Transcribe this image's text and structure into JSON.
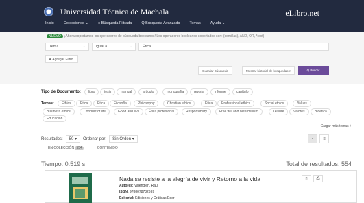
{
  "header": {
    "university": "Universidad Técnica de Machala",
    "brand": "eLibro.net",
    "nav": [
      "Inicio",
      "Colecciones ⌄",
      "≡ Búsqueda Filtrada",
      "Q Búsqueda Avanzada",
      "Temas",
      "Ayuda ⌄"
    ]
  },
  "search": {
    "notice_badge": "NUEVO",
    "notice": "¡Ahora soportamos los operadores de búsqueda booleanos! Los operadores booleanos soportados son: (comillas), AND, OR, *(ext)",
    "field": "Tema",
    "condition": "igual a",
    "value": "Ética",
    "add_filter": "✚ Agregar Filtro",
    "btn_guardar": "Guardar Búsqueda",
    "btn_mostrar": "Mostrar historial de búsquedas ▾",
    "btn_buscar": "Q Buscar"
  },
  "facets": {
    "tipo_label": "Tipo de Documento:",
    "tipos": [
      "libro",
      "tesis",
      "manual",
      "artículo",
      "monografía",
      "revista",
      "informe",
      "capítulo"
    ],
    "temas_label": "Temas:",
    "temas_row1": [
      "Ethics",
      "Ética",
      "Etica",
      "Filosofía",
      "Philosophy",
      "Christian ethics",
      "Ética",
      "Professional ethics",
      "Social ethics",
      "Values"
    ],
    "temas_row2": [
      "Business ethics",
      "Conduct of life",
      "Good and evil",
      "Ética profesional",
      "Responsibility",
      "Free will and determinism",
      "Leisure",
      "Valores",
      "Bioética"
    ],
    "temas_row3": [
      "Educación"
    ],
    "more": "Cargar más temas +"
  },
  "results": {
    "label": "Resultados:",
    "per_page": "50 ▾",
    "order_label": "Ordenar por:",
    "order": "Sin Orden ▾",
    "tab1": "EN COLECCIÓN",
    "tab1_count": "554",
    "tab2": "CONTENIDO",
    "tiempo": "Tiempo: 0.519 s",
    "total": "Total de resultados: 554"
  },
  "book": {
    "title": "Nada se resiste a la alegría de vivir y Retorno a la vida",
    "autores": "Valengien, Raúl",
    "isbn": "9788078732699",
    "editorial": "Ediciones y Gráficas Eder"
  }
}
